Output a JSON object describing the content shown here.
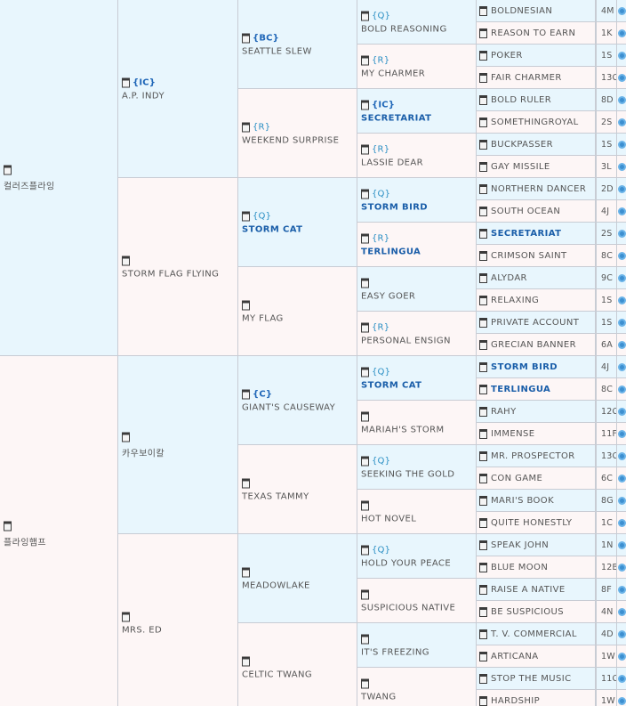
{
  "gen1": [
    {
      "name": "컬러즈플라잉",
      "code": "",
      "sex": "male"
    },
    {
      "name": "플라잉햄프",
      "code": "",
      "sex": "female"
    }
  ],
  "gen2": [
    {
      "name": "A.P. INDY",
      "code": "{IC}",
      "sex": "male"
    },
    {
      "name": "STORM FLAG FLYING",
      "code": "",
      "sex": "female"
    },
    {
      "name": "카우보이칼",
      "code": "",
      "sex": "male"
    },
    {
      "name": "MRS. ED",
      "code": "",
      "sex": "female"
    }
  ],
  "gen3": [
    {
      "name": "SEATTLE SLEW",
      "code": "{BC}",
      "sex": "male",
      "bold": false
    },
    {
      "name": "WEEKEND SURPRISE",
      "code": "{R}",
      "sex": "female",
      "bold": false
    },
    {
      "name": "STORM CAT",
      "code": "{Q}",
      "sex": "male",
      "bold": true
    },
    {
      "name": "MY FLAG",
      "code": "",
      "sex": "female",
      "bold": false
    },
    {
      "name": "GIANT'S CAUSEWAY",
      "code": "{C}",
      "sex": "male",
      "bold": false
    },
    {
      "name": "TEXAS TAMMY",
      "code": "",
      "sex": "female",
      "bold": false
    },
    {
      "name": "MEADOWLAKE",
      "code": "",
      "sex": "male",
      "bold": false
    },
    {
      "name": "CELTIC TWANG",
      "code": "",
      "sex": "female",
      "bold": false
    }
  ],
  "gen4": [
    {
      "name": "BOLD REASONING",
      "code": "{Q}",
      "sex": "male",
      "bold": false
    },
    {
      "name": "MY CHARMER",
      "code": "{R}",
      "sex": "female",
      "bold": false
    },
    {
      "name": "SECRETARIAT",
      "code": "{IC}",
      "sex": "male",
      "bold": true
    },
    {
      "name": "LASSIE DEAR",
      "code": "{R}",
      "sex": "female",
      "bold": false
    },
    {
      "name": "STORM BIRD",
      "code": "{Q}",
      "sex": "male",
      "bold": true
    },
    {
      "name": "TERLINGUA",
      "code": "{R}",
      "sex": "female",
      "bold": true
    },
    {
      "name": "EASY GOER",
      "code": "",
      "sex": "male",
      "bold": false
    },
    {
      "name": "PERSONAL ENSIGN",
      "code": "{R}",
      "sex": "female",
      "bold": false
    },
    {
      "name": "STORM CAT",
      "code": "{Q}",
      "sex": "male",
      "bold": true
    },
    {
      "name": "MARIAH'S STORM",
      "code": "",
      "sex": "female",
      "bold": false
    },
    {
      "name": "SEEKING THE GOLD",
      "code": "{Q}",
      "sex": "male",
      "bold": false
    },
    {
      "name": "HOT NOVEL",
      "code": "",
      "sex": "female",
      "bold": false
    },
    {
      "name": "HOLD YOUR PEACE",
      "code": "{Q}",
      "sex": "male",
      "bold": false
    },
    {
      "name": "SUSPICIOUS NATIVE",
      "code": "",
      "sex": "female",
      "bold": false
    },
    {
      "name": "IT'S FREEZING",
      "code": "",
      "sex": "male",
      "bold": false
    },
    {
      "name": "TWANG",
      "code": "",
      "sex": "female",
      "bold": false
    }
  ],
  "gen5": [
    {
      "name": "BOLDNESIAN",
      "ref": "4M",
      "bold": false
    },
    {
      "name": "REASON TO EARN",
      "ref": "1K",
      "bold": false
    },
    {
      "name": "POKER",
      "ref": "1S",
      "bold": false
    },
    {
      "name": "FAIR CHARMER",
      "ref": "13C",
      "bold": false
    },
    {
      "name": "BOLD RULER",
      "ref": "8D",
      "bold": false
    },
    {
      "name": "SOMETHINGROYAL",
      "ref": "2S",
      "bold": false
    },
    {
      "name": "BUCKPASSER",
      "ref": "1S",
      "bold": false
    },
    {
      "name": "GAY MISSILE",
      "ref": "3L",
      "bold": false
    },
    {
      "name": "NORTHERN DANCER",
      "ref": "2D",
      "bold": false
    },
    {
      "name": "SOUTH OCEAN",
      "ref": "4J",
      "bold": false
    },
    {
      "name": "SECRETARIAT",
      "ref": "2S",
      "bold": true
    },
    {
      "name": "CRIMSON SAINT",
      "ref": "8C",
      "bold": false
    },
    {
      "name": "ALYDAR",
      "ref": "9C",
      "bold": false
    },
    {
      "name": "RELAXING",
      "ref": "1S",
      "bold": false
    },
    {
      "name": "PRIVATE ACCOUNT",
      "ref": "1S",
      "bold": false
    },
    {
      "name": "GRECIAN BANNER",
      "ref": "6A",
      "bold": false
    },
    {
      "name": "STORM BIRD",
      "ref": "4J",
      "bold": true
    },
    {
      "name": "TERLINGUA",
      "ref": "8C",
      "bold": true
    },
    {
      "name": "RAHY",
      "ref": "12C",
      "bold": false
    },
    {
      "name": "IMMENSE",
      "ref": "11F",
      "bold": false
    },
    {
      "name": "MR. PROSPECTOR",
      "ref": "13C",
      "bold": false
    },
    {
      "name": "CON GAME",
      "ref": "6C",
      "bold": false
    },
    {
      "name": "MARI'S BOOK",
      "ref": "8G",
      "bold": false
    },
    {
      "name": "QUITE HONESTLY",
      "ref": "1C",
      "bold": false
    },
    {
      "name": "SPEAK JOHN",
      "ref": "1N",
      "bold": false
    },
    {
      "name": "BLUE MOON",
      "ref": "12B",
      "bold": false
    },
    {
      "name": "RAISE A NATIVE",
      "ref": "8F",
      "bold": false
    },
    {
      "name": "BE SUSPICIOUS",
      "ref": "4N",
      "bold": false
    },
    {
      "name": "T. V. COMMERCIAL",
      "ref": "4D",
      "bold": false
    },
    {
      "name": "ARTICANA",
      "ref": "1W",
      "bold": false
    },
    {
      "name": "STOP THE MUSIC",
      "ref": "11C",
      "bold": false
    },
    {
      "name": "HARDSHIP",
      "ref": "1W",
      "bold": false
    }
  ],
  "colors": {
    "male_bg": "#e8f6fd",
    "female_bg": "#fdf6f6",
    "link": "#1a5ea9",
    "code": "#2b8fc4",
    "border": "#c8ccd4"
  }
}
